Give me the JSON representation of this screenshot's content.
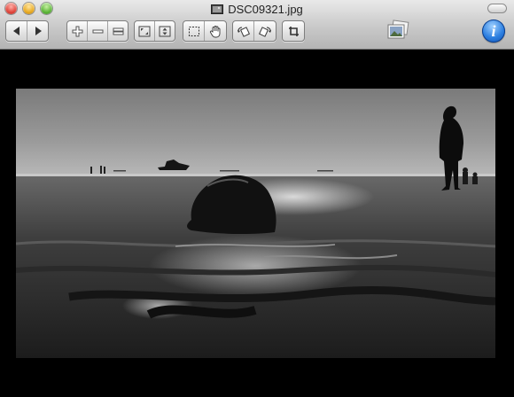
{
  "window": {
    "title": "DSC09321.jpg",
    "info_label": "i"
  },
  "toolbar": {
    "groups": [
      {
        "name": "navigation",
        "items": [
          "previous-icon",
          "next-icon"
        ]
      },
      {
        "name": "zoom",
        "items": [
          "zoom-in-icon",
          "zoom-out-icon",
          "actual-size-icon"
        ]
      },
      {
        "name": "fit",
        "items": [
          "fit-to-window-icon",
          "fit-vertical-icon"
        ]
      },
      {
        "name": "tools",
        "items": [
          "select-icon",
          "hand-icon"
        ]
      },
      {
        "name": "rotate",
        "items": [
          "rotate-left-icon",
          "rotate-right-icon"
        ]
      },
      {
        "name": "crop",
        "items": [
          "crop-icon"
        ]
      }
    ],
    "slideshow_icon": "slideshow-icon",
    "info_icon": "info-icon"
  },
  "colors": {
    "toolbar_top": "#e9e9e9",
    "toolbar_bottom": "#b4b4b4",
    "background": "#000000",
    "info_blue": "#2d7fe0"
  },
  "photo": {
    "description_icon": "black-and-white-beach-photo"
  }
}
